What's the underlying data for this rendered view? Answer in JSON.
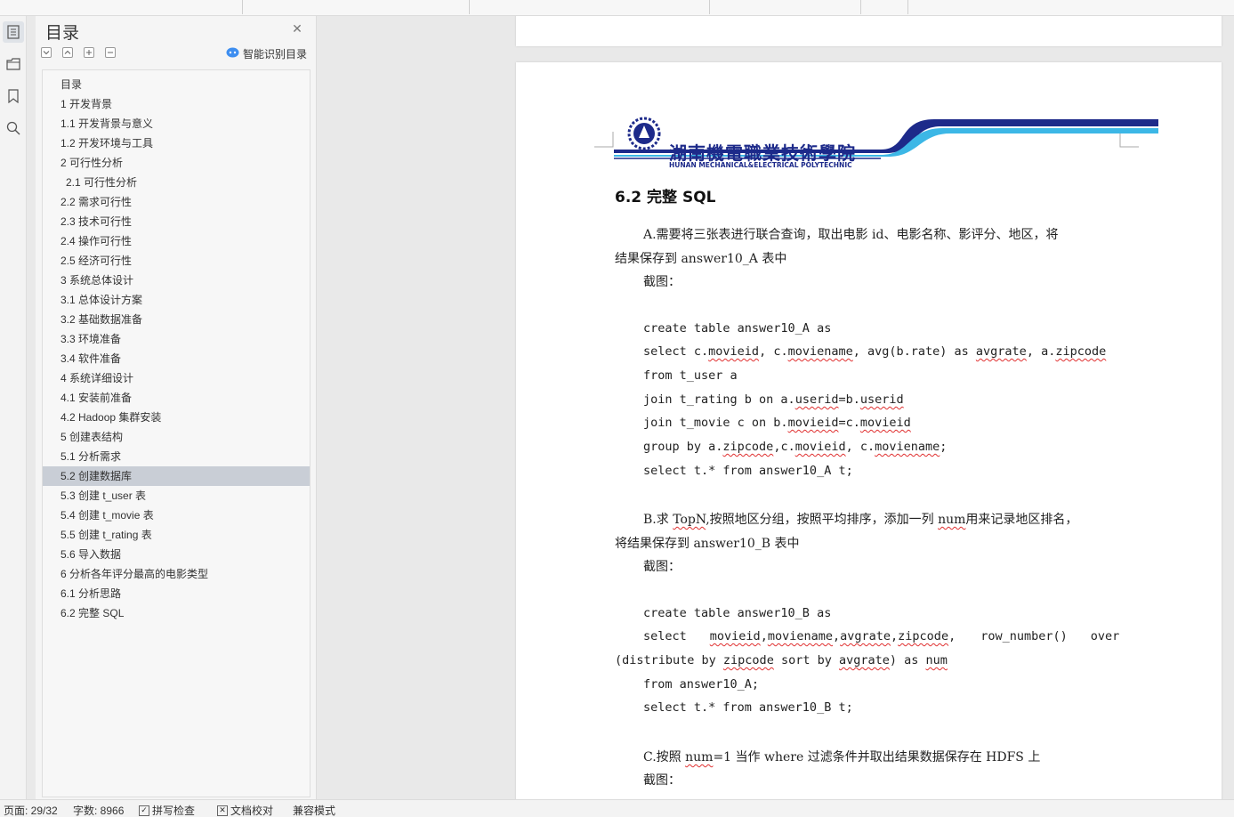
{
  "outline": {
    "title": "目录",
    "smart_toc_label": "智能识别目录",
    "items": [
      {
        "label": "目录"
      },
      {
        "label": "1  开发背景"
      },
      {
        "label": "1.1 开发背景与意义"
      },
      {
        "label": "1.2  开发环境与工具"
      },
      {
        "label": "2  可行性分析"
      },
      {
        "label": "2.1  可行性分析",
        "indent": true
      },
      {
        "label": "2.2  需求可行性"
      },
      {
        "label": "2.3  技术可行性"
      },
      {
        "label": "2.4  操作可行性"
      },
      {
        "label": "2.5 经济可行性"
      },
      {
        "label": "3  系统总体设计"
      },
      {
        "label": "3.1  总体设计方案"
      },
      {
        "label": "3.2  基础数据准备"
      },
      {
        "label": "3.3  环境准备"
      },
      {
        "label": "3.4  软件准备"
      },
      {
        "label": "4  系统详细设计"
      },
      {
        "label": "4.1  安装前准备"
      },
      {
        "label": "4.2 Hadoop 集群安装"
      },
      {
        "label": "5  创建表结构"
      },
      {
        "label": "5.1  分析需求"
      },
      {
        "label": "5.2  创建数据库",
        "active": true
      },
      {
        "label": "5.3  创建 t_user 表"
      },
      {
        "label": "5.4  创建 t_movie 表"
      },
      {
        "label": "5.5  创建 t_rating 表"
      },
      {
        "label": "5.6  导入数据"
      },
      {
        "label": "6  分析各年评分最高的电影类型"
      },
      {
        "label": "6.1  分析思路"
      },
      {
        "label": "6.2  完整 SQL"
      }
    ]
  },
  "document": {
    "logo_cn": "湖南機電職業技術學院",
    "logo_en": "HUNAN MECHANICAL&ELECTRICAL POLYTECHNIC",
    "heading": "6.2  完整 SQL",
    "a_line1": "A.需要将三张表进行联合查询，取出电影 id、电影名称、影评分、地区，将",
    "a_line2": "结果保存到 answer10_A 表中",
    "screenshot_label": "截图：",
    "sql_a1": "create table answer10_A as",
    "sql_a2_1": "select c.",
    "sql_a2_2": "movieid",
    "sql_a2_3": ", c.",
    "sql_a2_4": "moviename",
    "sql_a2_5": ", avg(b.rate) as ",
    "sql_a2_6": "avgrate",
    "sql_a2_7": ", a.",
    "sql_a2_8": "zipcode",
    "sql_a3": "from t_user a",
    "sql_a4_1": "join t_rating b on a.",
    "sql_a4_2": "userid",
    "sql_a4_3": "=b.",
    "sql_a4_4": "userid",
    "sql_a5_1": "join t_movie c on b.",
    "sql_a5_2": "movieid",
    "sql_a5_3": "=c.",
    "sql_a5_4": "movieid",
    "sql_a6_1": "group by a.",
    "sql_a6_2": "zipcode",
    "sql_a6_3": ",c.",
    "sql_a6_4": "movieid",
    "sql_a6_5": ", c.",
    "sql_a6_6": "moviename",
    "sql_a6_7": ";",
    "sql_a7": "select t.* from answer10_A t;",
    "b_line1_1": "B.求 ",
    "b_line1_2": "TopN",
    "b_line1_3": ",按照地区分组，按照平均排序，添加一列 ",
    "b_line1_4": "num",
    "b_line1_5": "用来记录地区排名，",
    "b_line2": "将结果保存到 answer10_B 表中",
    "sql_b1": "create table answer10_B as",
    "sql_b2_1": "select",
    "sql_b2_2": "movieid",
    "sql_b2_3": ",",
    "sql_b2_4": "moviename",
    "sql_b2_5": ",",
    "sql_b2_6": "avgrate",
    "sql_b2_7": ",",
    "sql_b2_8": "zipcode",
    "sql_b2_9": ",",
    "sql_b2_10": "row_number()",
    "sql_b2_11": "over",
    "sql_b3_1": "(distribute by ",
    "sql_b3_2": "zipcode",
    "sql_b3_3": " sort by ",
    "sql_b3_4": "avgrate",
    "sql_b3_5": ") as ",
    "sql_b3_6": "num",
    "sql_b4": "from answer10_A;",
    "sql_b5": "select t.* from answer10_B t;",
    "c_line1_1": "C.按照 ",
    "c_line1_2": "num",
    "c_line1_3": "=1 当作 where 过滤条件并取出结果数据保存在 HDFS 上"
  },
  "statusbar": {
    "page": "页面: 29/32",
    "words": "字数: 8966",
    "spellcheck": "拼写检查",
    "proofread": "文档校对",
    "compat": "兼容模式"
  },
  "colors": {
    "logo_blue": "#1d2a8a",
    "logo_cyan": "#3cb7e6",
    "active_toc": "#c9ced6",
    "spell_underline": "#e03030"
  },
  "icons": [
    "outline-icon",
    "navigation-icon",
    "bookmark-icon",
    "search-icon",
    "close-icon",
    "smart-toc-icon"
  ]
}
